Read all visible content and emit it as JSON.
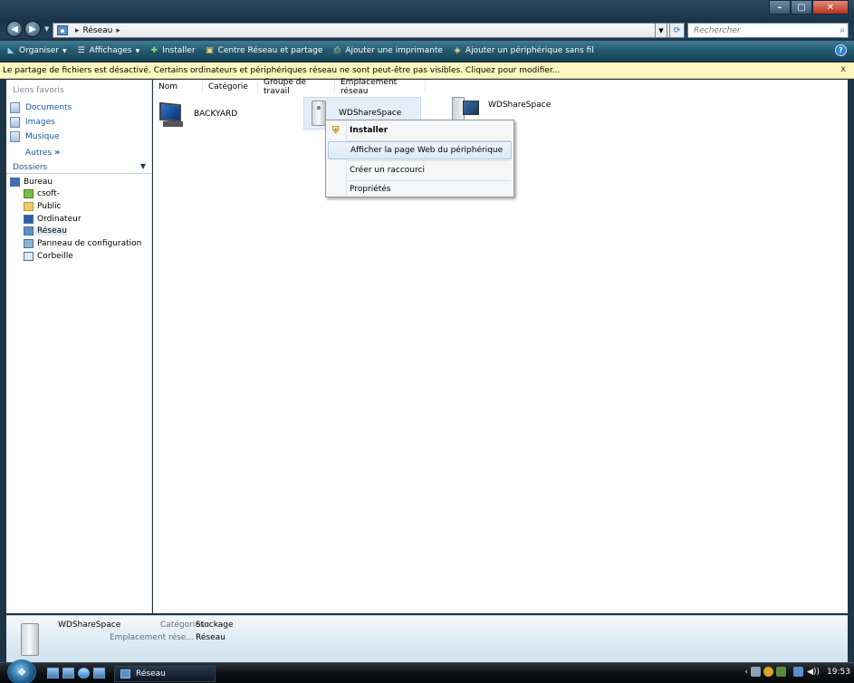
{
  "window": {
    "address": {
      "location": "Réseau"
    },
    "search": {
      "placeholder": "Rechercher"
    },
    "controls": {
      "minimize": "–",
      "maximize": "▢",
      "close": "✕"
    }
  },
  "toolbar": {
    "organize": "Organiser",
    "views": "Affichages",
    "install": "Installer",
    "network_center": "Centre Réseau et partage",
    "add_printer": "Ajouter une imprimante",
    "add_wireless": "Ajouter un périphérique sans fil"
  },
  "infobar": {
    "message": "Le partage de fichiers est désactivé. Certains ordinateurs et périphériques réseau ne sont peut-être pas visibles. Cliquez pour modifier...",
    "close": "x"
  },
  "navpane": {
    "favorites_header": "Liens favoris",
    "favorites": [
      {
        "label": "Documents",
        "icon": "documents-icon"
      },
      {
        "label": "Images",
        "icon": "images-icon"
      },
      {
        "label": "Musique",
        "icon": "music-icon"
      }
    ],
    "more": "Autres",
    "folders_header": "Dossiers",
    "tree": [
      {
        "label": "Bureau",
        "icon": "desktop-icon"
      },
      {
        "label": "csoft-",
        "icon": "user-folder-icon"
      },
      {
        "label": "Public",
        "icon": "folder-icon"
      },
      {
        "label": "Ordinateur",
        "icon": "computer-icon"
      },
      {
        "label": "Réseau",
        "icon": "network-icon"
      },
      {
        "label": "Panneau de configuration",
        "icon": "control-panel-icon"
      },
      {
        "label": "Corbeille",
        "icon": "recycle-bin-icon"
      }
    ]
  },
  "content": {
    "columns": [
      "Nom",
      "Catégorie",
      "Groupe de travail",
      "Emplacement réseau"
    ],
    "items": [
      {
        "name": "BACKYARD",
        "icon": "computer-icon"
      },
      {
        "name": "WDShareSpace",
        "icon": "nas-storage-icon"
      },
      {
        "name": "WDShareSpace",
        "icon": "media-device-icon"
      }
    ]
  },
  "context_menu": {
    "items": [
      "Installer",
      "Afficher la page Web du périphérique",
      "Créer un raccourci",
      "Propriétés"
    ]
  },
  "details": {
    "name": "WDShareSpace",
    "category_label": "Catégories :",
    "category_value": "Stockage",
    "location_label": "Emplacement rése...",
    "location_value": "Réseau"
  },
  "taskbar": {
    "task_label": "Réseau",
    "clock": "19:53"
  }
}
